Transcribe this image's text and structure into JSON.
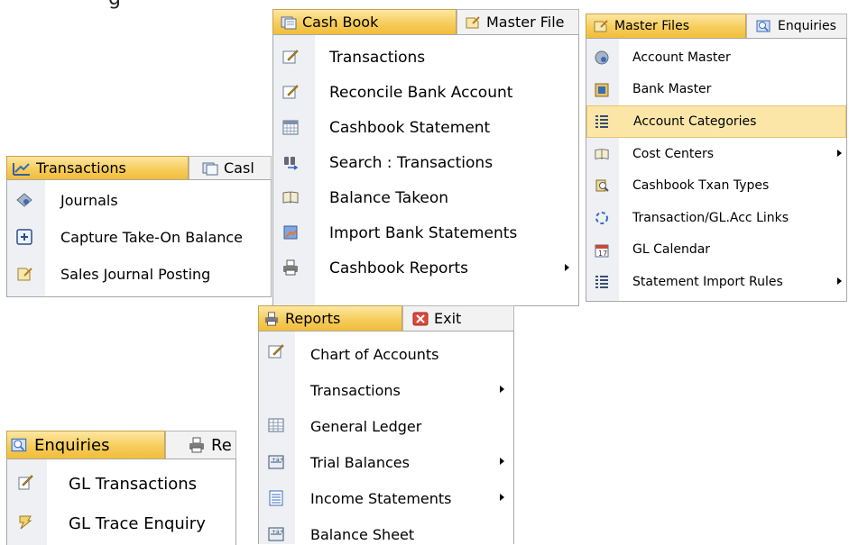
{
  "transactions_panel": {
    "tabs": [
      {
        "label": "Transactions",
        "icon": "transactions-icon",
        "active": true
      },
      {
        "label": "Casl",
        "icon": "cashbook-icon",
        "active": false
      }
    ],
    "items": [
      {
        "label": "Journals",
        "icon": "journals-icon"
      },
      {
        "label": "Capture Take-On Balance",
        "icon": "capture-icon"
      },
      {
        "label": "Sales Journal Posting",
        "icon": "sales-journal-icon"
      }
    ]
  },
  "cashbook_panel": {
    "tabs": [
      {
        "label": "Cash Book",
        "icon": "cashbook-icon",
        "active": true
      },
      {
        "label": "Master File",
        "icon": "master-files-icon",
        "active": false
      }
    ],
    "items": [
      {
        "label": "Transactions",
        "icon": "edit-icon",
        "submenu": false
      },
      {
        "label": "Reconcile Bank Account",
        "icon": "edit-icon",
        "submenu": false
      },
      {
        "label": "Cashbook Statement",
        "icon": "calendar-grid-icon",
        "submenu": false
      },
      {
        "label": "Search : Transactions",
        "icon": "binoculars-icon",
        "submenu": false
      },
      {
        "label": "Balance Takeon",
        "icon": "book-icon",
        "submenu": false
      },
      {
        "label": "Import Bank Statements",
        "icon": "import-icon",
        "submenu": false
      },
      {
        "label": "Cashbook Reports",
        "icon": "printer-icon",
        "submenu": true
      }
    ]
  },
  "masterfiles_panel": {
    "tabs": [
      {
        "label": "Master Files",
        "icon": "master-files-icon",
        "active": true
      },
      {
        "label": "Enquiries",
        "icon": "enquiries-icon",
        "active": false
      }
    ],
    "items": [
      {
        "label": "Account Master",
        "icon": "account-master-icon",
        "submenu": false,
        "highlighted": false
      },
      {
        "label": "Bank Master",
        "icon": "bank-master-icon",
        "submenu": false,
        "highlighted": false
      },
      {
        "label": "Account Categories",
        "icon": "list-icon",
        "submenu": false,
        "highlighted": true
      },
      {
        "label": "Cost Centers",
        "icon": "book-icon",
        "submenu": true,
        "highlighted": false
      },
      {
        "label": "Cashbook Txan Types",
        "icon": "magnifier-icon",
        "submenu": false,
        "highlighted": false
      },
      {
        "label": "Transaction/GL.Acc Links",
        "icon": "link-icon",
        "submenu": false,
        "highlighted": false
      },
      {
        "label": "GL Calendar",
        "icon": "calendar-icon",
        "submenu": false,
        "highlighted": false
      },
      {
        "label": "Statement Import Rules",
        "icon": "list-icon",
        "submenu": true,
        "highlighted": false
      }
    ]
  },
  "reports_panel": {
    "tabs": [
      {
        "label": "Reports",
        "icon": "printer-icon",
        "active": true
      },
      {
        "label": "Exit",
        "icon": "exit-icon",
        "active": false
      }
    ],
    "items": [
      {
        "label": "Chart of Accounts",
        "icon": "edit-icon",
        "submenu": false
      },
      {
        "label": "Transactions",
        "icon": "",
        "submenu": true
      },
      {
        "label": "General Ledger",
        "icon": "ledger-grid-icon",
        "submenu": false
      },
      {
        "label": "Trial Balances",
        "icon": "balance-icon",
        "submenu": true
      },
      {
        "label": "Income Statements",
        "icon": "statement-icon",
        "submenu": true
      },
      {
        "label": "Balance Sheet",
        "icon": "balance-icon",
        "submenu": false
      }
    ]
  },
  "enquiries_panel": {
    "tabs": [
      {
        "label": "Enquiries",
        "icon": "enquiries-icon",
        "active": true
      },
      {
        "label": "Re",
        "icon": "printer-icon",
        "active": false
      }
    ],
    "items": [
      {
        "label": "GL Transactions",
        "icon": "gl-transactions-icon"
      },
      {
        "label": "GL Trace Enquiry",
        "icon": "gl-trace-icon"
      }
    ]
  },
  "top_fragment": "g",
  "colors": {
    "active_tab": "#f6cd5c",
    "highlight": "#fbe6a8",
    "gutter": "#eef0f3",
    "border": "#a8a8a8"
  }
}
